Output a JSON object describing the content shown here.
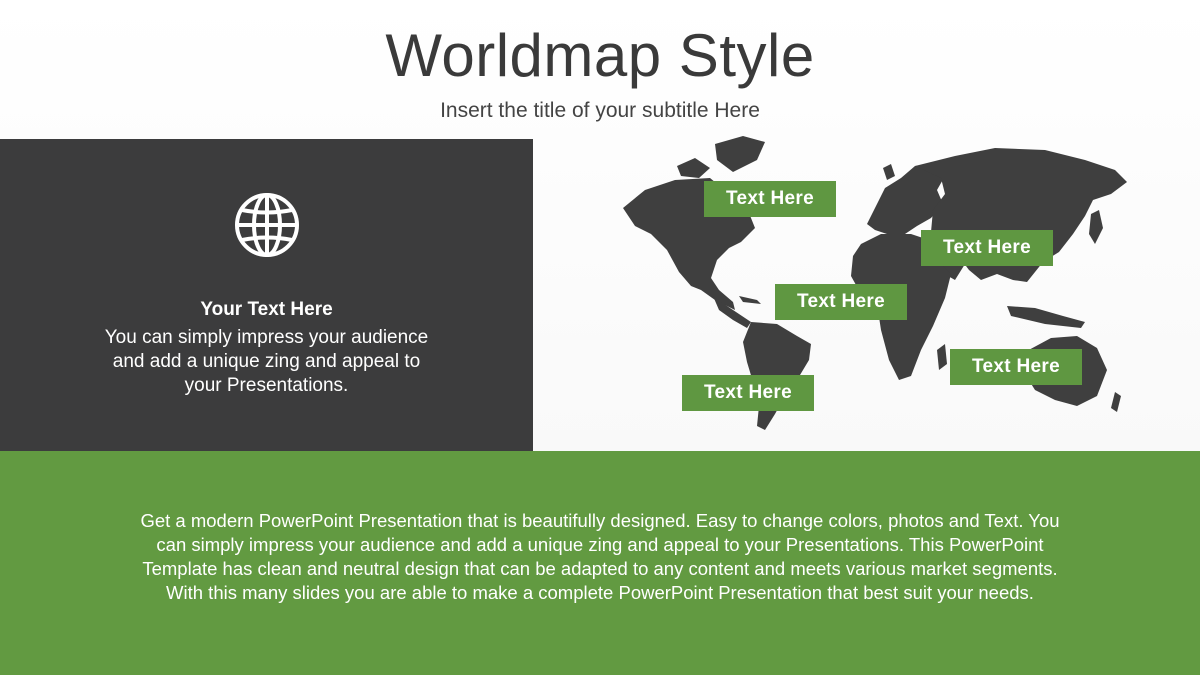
{
  "header": {
    "title": "Worldmap Style",
    "subtitle": "Insert the title of your subtitle Here"
  },
  "panel": {
    "icon": "globe-icon",
    "heading": "Your Text Here",
    "body": "You can simply impress your audience and add a unique zing and appeal to your Presentations."
  },
  "map": {
    "labels": [
      "Text Here",
      "Text Here",
      "Text Here",
      "Text Here",
      "Text Here"
    ]
  },
  "footer": {
    "body": "Get a modern PowerPoint  Presentation that is beautifully designed.  Easy to change colors, photos and Text. You can simply impress your audience and add a unique zing and appeal to your Presentations. This PowerPoint Template has clean and neutral design that can be adapted to any content and meets various market segments. With this many slides you are able to make a complete PowerPoint Presentation that best suit your needs."
  },
  "colors": {
    "accent_green": "#629a41",
    "label_green": "#5f9741",
    "dark_panel": "#3c3c3d",
    "map_gray": "#3f3f3f"
  }
}
